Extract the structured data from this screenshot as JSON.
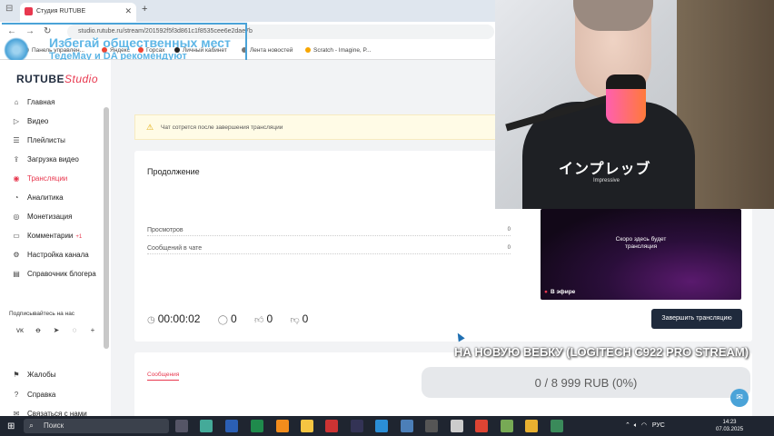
{
  "browser": {
    "tab_title": "Студия RUTUBE",
    "url": "studio.rutube.ru/stream/201592f5f3d861c1f8535cee6e2dae7b",
    "bookmarks": [
      "Панель управлен...",
      "Яндекс",
      "Горсах",
      "Личный кабинет",
      "Лента новостей",
      "Scratch - Imagine, P..."
    ]
  },
  "overlay": {
    "line1": "Избегай общественных мест",
    "line2": "ТедеМау и DA рекомендуют"
  },
  "sidebar": {
    "logo_main": "RUTUBE",
    "logo_sub": "Studio",
    "items": [
      {
        "label": "Главная",
        "icon": "home-icon"
      },
      {
        "label": "Видео",
        "icon": "video-icon"
      },
      {
        "label": "Плейлисты",
        "icon": "list-icon"
      },
      {
        "label": "Загрузка видео",
        "icon": "upload-icon"
      },
      {
        "label": "Трансляции",
        "icon": "broadcast-icon",
        "active": true
      },
      {
        "label": "Аналитика",
        "icon": "analytics-icon"
      },
      {
        "label": "Монетизация",
        "icon": "money-icon"
      },
      {
        "label": "Комментарии",
        "icon": "comments-icon",
        "badge": "+1"
      },
      {
        "label": "Настройка канала",
        "icon": "settings-icon"
      },
      {
        "label": "Справочник блогера",
        "icon": "book-icon"
      }
    ],
    "follow_label": "Подписывайтесь на нас",
    "bottom_items": [
      {
        "label": "Жалобы",
        "icon": "flag-icon"
      },
      {
        "label": "Справка",
        "icon": "help-icon"
      },
      {
        "label": "Связаться с нами",
        "icon": "mail-icon"
      }
    ]
  },
  "main": {
    "notice": "Чат сотрется после завершения трансляции",
    "card_title": "Продолжение",
    "stats": [
      {
        "label": "Просмотров",
        "value": "0"
      },
      {
        "label": "Сообщений в чате",
        "value": "0"
      }
    ],
    "timer": "00:00:02",
    "viewers": "0",
    "likes": "0",
    "dislikes": "0",
    "preview_text_1": "Скоро здесь будет",
    "preview_text_2": "трансляция",
    "live_label": "В эфире",
    "end_button": "Завершить трансляцию",
    "messages_tab": "Сообщения"
  },
  "webcam": {
    "shirt_text": "インプレッブ",
    "shirt_sub": "Impressive"
  },
  "donation": {
    "title": "НА НОВУЮ ВЕБКУ (LOGITECH C922 PRO STREAM)",
    "progress_text": "0 / 8 999 RUB (0%)",
    "progress_fraction": 0
  },
  "taskbar": {
    "search_placeholder": "Поиск",
    "language": "РУС",
    "time": "14:23",
    "date": "07.03.2025"
  },
  "colors": {
    "accent": "#e8384f",
    "brand_dark": "#1f2a3c",
    "overlay_blue": "#5eb6e6"
  }
}
